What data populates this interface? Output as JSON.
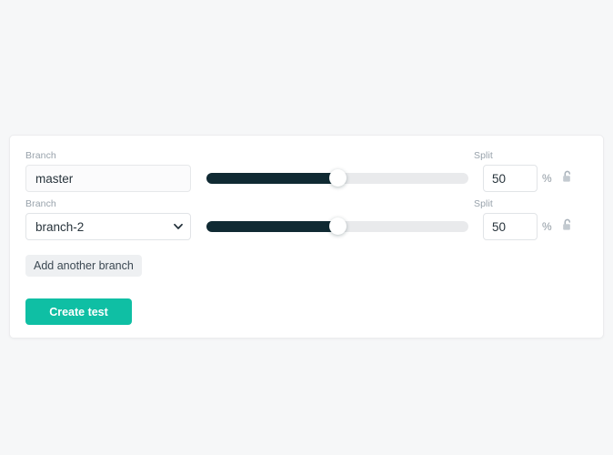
{
  "colors": {
    "page_background": "#f6f7f8",
    "card_background": "#ffffff",
    "slider_fill": "#102a33",
    "slider_track": "#e9eaec",
    "primary_button": "#0fbfa4",
    "secondary_button": "#eef0f2",
    "label_muted": "#98a2ab"
  },
  "form": {
    "branches": [
      {
        "branch_label": "Branch",
        "branch_value": "master",
        "branch_control": "text-input",
        "slider_value": 50,
        "slider_min": 0,
        "slider_max": 100,
        "split_label": "Split",
        "split_value": "50",
        "percent_symbol": "%",
        "lock_icon": "unlock-icon",
        "locked": false
      },
      {
        "branch_label": "Branch",
        "branch_value": "branch-2",
        "branch_control": "select",
        "branch_options": [
          "branch-2"
        ],
        "slider_value": 50,
        "slider_min": 0,
        "slider_max": 100,
        "split_label": "Split",
        "split_value": "50",
        "percent_symbol": "%",
        "lock_icon": "unlock-icon",
        "locked": false
      }
    ],
    "add_branch_label": "Add another branch",
    "submit_label": "Create test"
  }
}
